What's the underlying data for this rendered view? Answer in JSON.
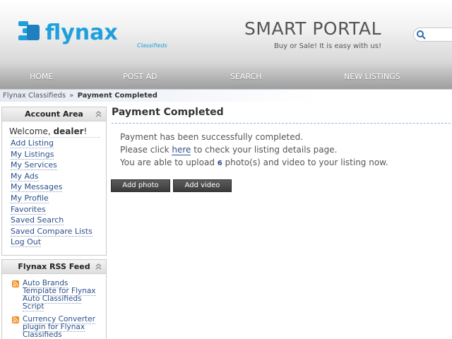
{
  "header": {
    "logo_text": "flynax",
    "logo_sub": "Classifieds",
    "title": "SMART PORTAL",
    "slogan": "Buy or Sale! It is easy with us!"
  },
  "nav": {
    "items": [
      "HOME",
      "POST AD",
      "SEARCH",
      "NEW LISTINGS"
    ]
  },
  "breadcrumb": {
    "root": "Flynax Classifieds",
    "separator": "»",
    "current": "Payment Completed"
  },
  "account_block": {
    "title": "Account Area",
    "welcome_prefix": "Welcome, ",
    "user": "dealer",
    "welcome_suffix": "!",
    "menu": [
      "Add Listing",
      "My Listings",
      "My Services",
      "My Ads",
      "My Messages",
      "My Profile",
      "Favorites",
      "Saved Search",
      "Saved Compare Lists",
      "Log Out"
    ]
  },
  "rss_block": {
    "title": "Flynax RSS Feed",
    "items": [
      "Auto Brands Template for Flynax Auto Classifieds Script",
      "Currency Converter plugin for Flynax Classifieds"
    ]
  },
  "main": {
    "title": "Payment Completed",
    "line1": "Payment has been successfully completed.",
    "line2_pre": "Please click ",
    "line2_link": "here",
    "line2_post": " to check your listing details page.",
    "line3_pre": "You are able to upload ",
    "line3_num": "6",
    "line3_post": " photo(s) and video to your listing now.",
    "buttons": [
      "Add photo",
      "Add video"
    ]
  },
  "colors": {
    "link": "#2d4f8a",
    "logo_blue": "#1ea0dc",
    "button_bg": "#4a4a4a"
  },
  "icons": [
    "search-icon",
    "collapse-icon",
    "rss-icon"
  ]
}
